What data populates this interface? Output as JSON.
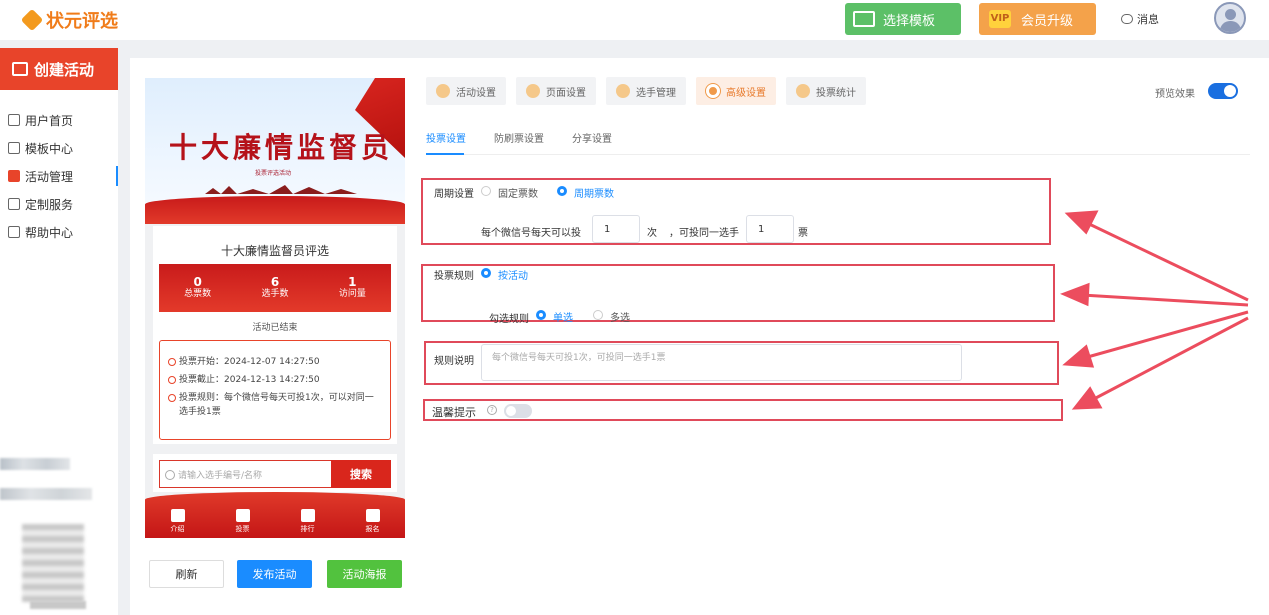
{
  "header": {
    "logo": "状元评选",
    "template_btn": "选择模板",
    "vip_icon": "VIP",
    "vip_btn": "会员升级",
    "messages": "消息"
  },
  "sidebar": {
    "create": "创建活动",
    "items": [
      {
        "label": "用户首页",
        "icon": "home-icon"
      },
      {
        "label": "模板中心",
        "icon": "folder-icon"
      },
      {
        "label": "活动管理",
        "icon": "activity-icon"
      },
      {
        "label": "定制服务",
        "icon": "link-icon"
      },
      {
        "label": "帮助中心",
        "icon": "help-icon"
      }
    ]
  },
  "preview": {
    "banner_title": "十大廉情监督员",
    "banner_sub": "投票评选活动",
    "activity_name": "十大廉情监督员评选",
    "stats": [
      {
        "value": "0",
        "label": "总票数"
      },
      {
        "value": "6",
        "label": "选手数"
      },
      {
        "value": "1",
        "label": "访问量"
      }
    ],
    "status": "活动已结束",
    "info": [
      {
        "text": "投票开始：2024-12-07 14:27:50"
      },
      {
        "text": "投票截止：2024-12-13 14:27:50"
      },
      {
        "text": "投票规则：每个微信号每天可投1次，可以对同一选手投1票"
      }
    ],
    "search_placeholder": "请输入选手编号/名称",
    "search_btn": "搜索",
    "tabs": [
      "介绍",
      "投票",
      "排行",
      "报名"
    ]
  },
  "actions": {
    "refresh": "刷新",
    "publish": "发布活动",
    "poster": "活动海报"
  },
  "top_tabs": [
    "活动设置",
    "页面设置",
    "选手管理",
    "高级设置",
    "投票统计"
  ],
  "preview_effect": "预览效果",
  "sub_tabs": [
    "投票设置",
    "防刷票设置",
    "分享设置"
  ],
  "form": {
    "cycle_label": "周期设置",
    "cycle_opt1": "固定票数",
    "cycle_opt2": "周期票数",
    "per_day_text": "每个微信号每天可以投",
    "per_day_value": "1",
    "times_unit": "次",
    "same_player_text": "，可投同一选手",
    "same_player_value": "1",
    "votes_unit": "票",
    "rule_label": "投票规则",
    "rule_opt": "按活动",
    "check_label": "勾选规则",
    "check_single": "单选",
    "check_multi": "多选",
    "desc_label": "规则说明",
    "desc_placeholder": "每个微信号每天可投1次，可投同一选手1票",
    "tip_label": "温馨提示",
    "tip_icon": "?"
  }
}
